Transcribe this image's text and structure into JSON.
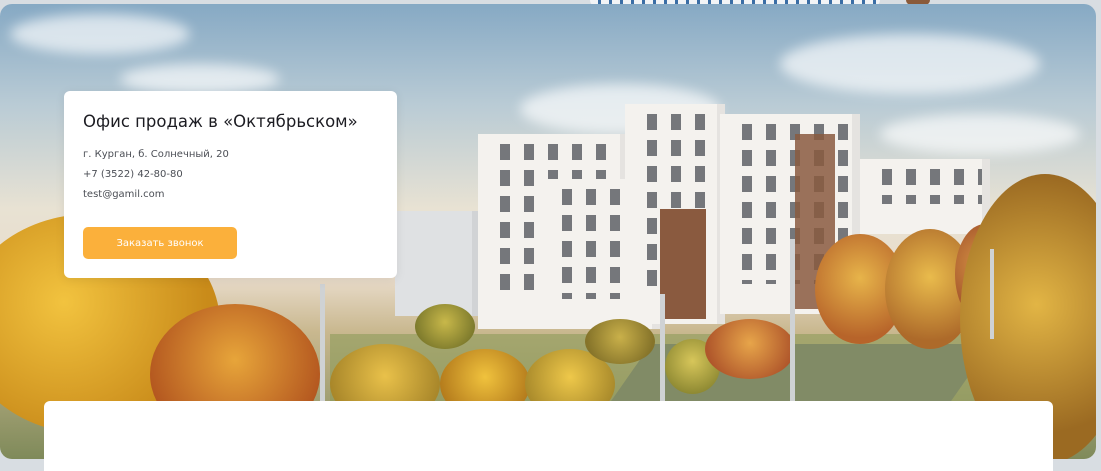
{
  "office": {
    "title": "Офис продаж в «Октябрьском»",
    "address": "г. Курган, б. Солнечный, 20",
    "phone": "+7 (3522) 42-80-80",
    "email": "test@gamil.com",
    "callback_button": "Заказать звонок"
  },
  "colors": {
    "accent": "#fbb03b",
    "card_background": "#ffffff",
    "title_text": "#1c1c22",
    "body_text": "#4b4e55"
  }
}
